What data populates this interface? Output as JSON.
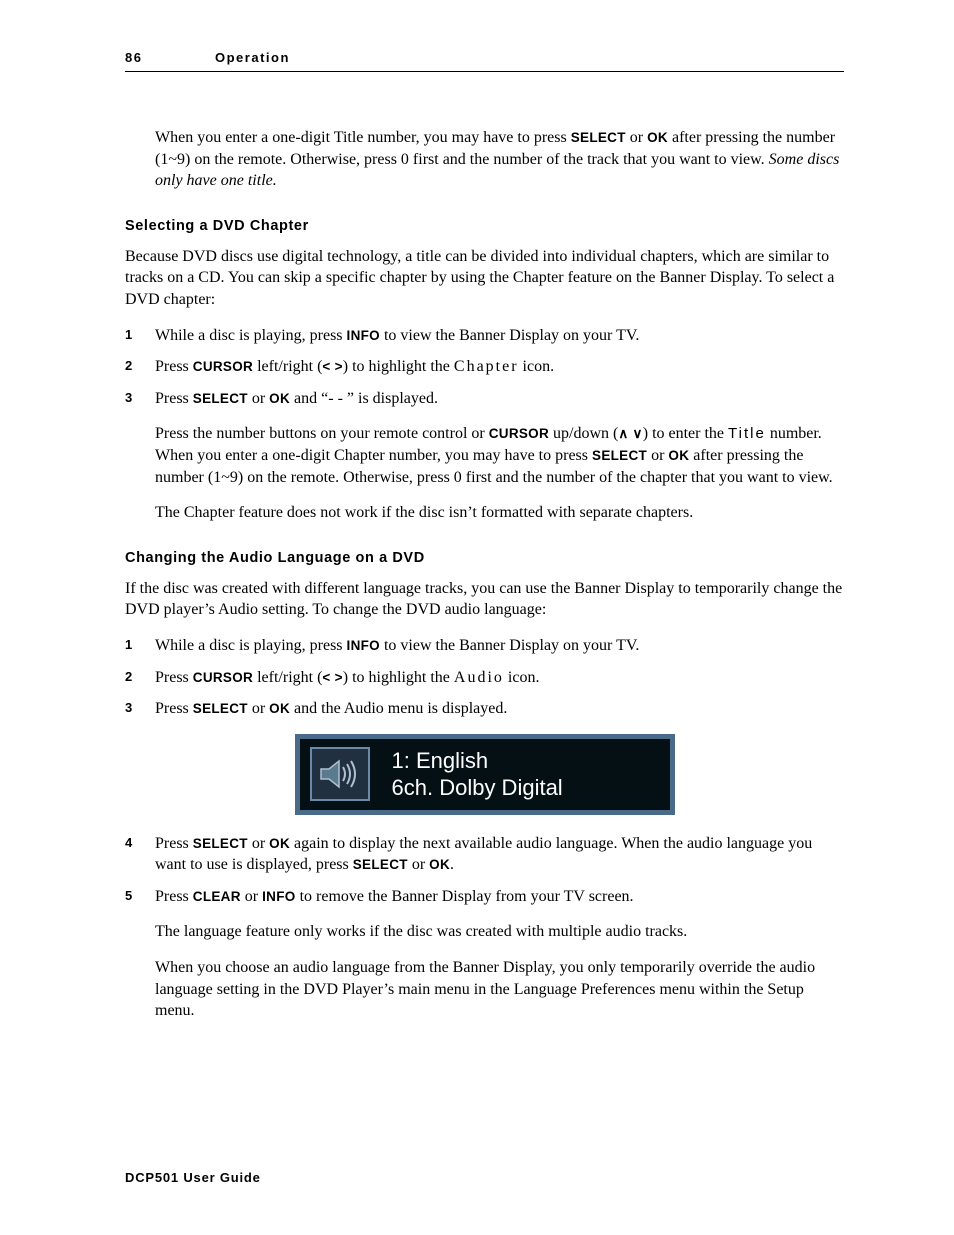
{
  "header": {
    "page_number": "86",
    "section": "Operation"
  },
  "keys": {
    "select": "SELECT",
    "ok": "OK",
    "info": "INFO",
    "cursor": "CURSOR",
    "clear": "CLEAR"
  },
  "intro_paragraph": {
    "pre": "When you enter a one-digit Title number, you may have to press ",
    "mid1": " or ",
    "post1": " after pressing the number (1~9) on the remote. Otherwise, press 0 first and the number of the track that you want to view. ",
    "italic_tail": "Some discs only have one title."
  },
  "section_chapter": {
    "heading": "Selecting a DVD Chapter",
    "intro": "Because DVD discs use digital technology, a title can be divided into individual chapters, which are similar to tracks on a CD. You can skip a specific chapter by using the Chapter feature on the Banner Display. To select a DVD chapter:",
    "steps": {
      "s1_pre": "While a disc is playing, press ",
      "s1_post": " to view the Banner Display on your TV.",
      "s2_pre": "Press ",
      "s2_mid": " left/right (",
      "s2_lt": "<",
      "s2_gt": ">",
      "s2_post1": ") to highlight the ",
      "s2_spaced": "Chapter",
      "s2_post2": " icon.",
      "s3_pre": "Press ",
      "s3_or": " or ",
      "s3_post": " and “-  - ” is displayed."
    },
    "note1": {
      "a": "Press the number buttons on your remote control or ",
      "b": " up/down (",
      "up": "∧",
      "sp": " ",
      "down": "∨",
      "c": ") to enter the ",
      "title_spaced": "Title",
      "d": " number. When you enter a one-digit Chapter number, you may have to press ",
      "or": " or ",
      "e": " after pressing the number (1~9) on the remote. Otherwise, press 0 first and the number of the chapter that you want to view."
    },
    "note2": "The Chapter feature does not work if the disc isn’t formatted with separate chapters."
  },
  "section_audio": {
    "heading": "Changing the Audio Language on a DVD",
    "intro": "If the disc was created with different language tracks, you can use the Banner Display to temporarily change the DVD player’s Audio setting. To change the DVD audio language:",
    "steps": {
      "s1_pre": "While a disc is playing, press ",
      "s1_post": " to view the Banner Display on your TV.",
      "s2_pre": "Press ",
      "s2_mid": " left/right (",
      "s2_lt": "<",
      "s2_gt": ">",
      "s2_post1": ") to highlight the ",
      "s2_spaced": "Audio",
      "s2_post2": " icon.",
      "s3_pre": "Press ",
      "s3_or": " or ",
      "s3_post": " and the Audio menu is displayed.",
      "s4_pre": "Press ",
      "s4_or1": " or ",
      "s4_mid": " again to display the next available audio language. When the audio language you want to use is displayed, press ",
      "s4_or2": " or ",
      "s4_post": ".",
      "s5_pre": "Press ",
      "s5_or": " or ",
      "s5_post": " to remove the Banner Display from your TV screen."
    },
    "display": {
      "line1": "1: English",
      "line2": "6ch. Dolby Digital"
    },
    "note1": "The language feature only works if the disc was created with multiple audio tracks.",
    "note2": "When you choose an audio language from the Banner Display, you only temporarily override the audio language setting in the DVD Player’s main menu in the Language Preferences menu within the Setup menu."
  },
  "footer": "DCP501 User Guide"
}
